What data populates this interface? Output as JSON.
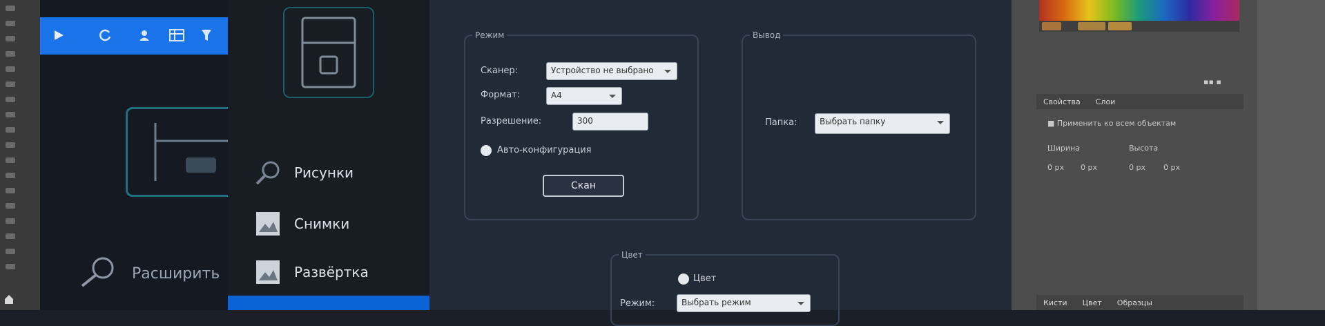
{
  "back_app": {
    "toolbar_icons": [
      "play-icon",
      "refresh-icon",
      "person-icon",
      "table-icon",
      "filter-icon"
    ],
    "search_label": "Расширить"
  },
  "sidebar": {
    "items": [
      {
        "label": "Рисунки",
        "icon": "search-icon"
      },
      {
        "label": "Снимки",
        "icon": "image-icon"
      },
      {
        "label": "Развёртка",
        "icon": "image-icon"
      }
    ]
  },
  "dialog": {
    "group_main": {
      "legend": "Режим",
      "row1_label": "Сканер:",
      "row1_value": "Устройство не выбрано",
      "row2_label": "Формат:",
      "row2_value": "A4",
      "row3_label": "Разрешение:",
      "row3_value": "300",
      "check_label": "Авто-конфигурация",
      "button_label": "Скан"
    },
    "group_output": {
      "legend": "Вывод",
      "row_label": "Папка:",
      "row_value": "Выбрать папку"
    },
    "group_bottom": {
      "legend": "Цвет",
      "radio_label": "Цвет",
      "row_label": "Режим:",
      "row_value": "Выбрать режим"
    }
  },
  "right_panel": {
    "tabs_top": [
      "Свойства",
      "Слои"
    ],
    "checkbox_text": "Применить ко всем объектам",
    "row_a": [
      "Ширина",
      "Высота"
    ],
    "row_b": [
      "0 px",
      "0 px",
      "0 px",
      "0 px"
    ],
    "tabs_bottom": [
      "Кисти",
      "Цвет",
      "Образцы"
    ]
  }
}
